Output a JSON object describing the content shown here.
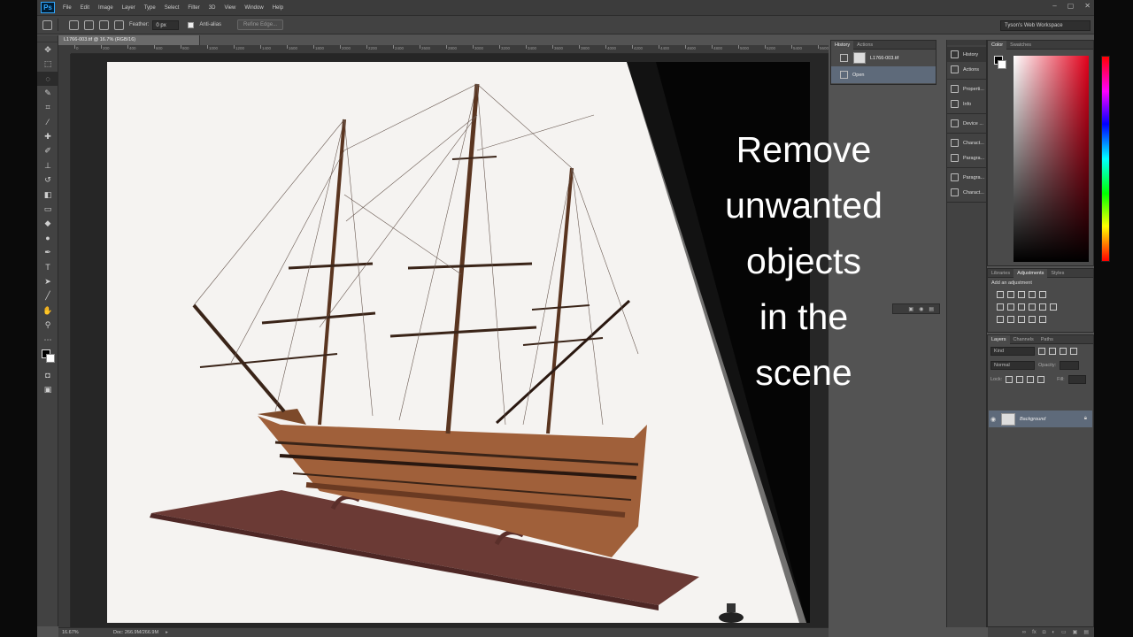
{
  "app": {
    "logo": "Ps",
    "menu": [
      "File",
      "Edit",
      "Image",
      "Layer",
      "Type",
      "Select",
      "Filter",
      "3D",
      "View",
      "Window",
      "Help"
    ],
    "window_controls": [
      "–",
      "▢",
      "✕"
    ]
  },
  "options": {
    "feather_label": "Feather:",
    "feather_value": "0 px",
    "antialias_label": "Anti-alias",
    "refine_edge_label": "Refine Edge...",
    "workspace": "Tyson's Web Workspace"
  },
  "document": {
    "tab_title": "L1766-003.tif @ 16.7% (RGB/16)",
    "zoom": "16.67%",
    "doc_size": "Doc: 266.9M/266.9M",
    "ruler_labels": [
      "0",
      "200",
      "400",
      "600",
      "800",
      "1000",
      "1200",
      "1400",
      "1600",
      "1800",
      "2000",
      "2200",
      "2400",
      "2600",
      "2800",
      "3000",
      "3200",
      "3400",
      "3600",
      "3800",
      "4000",
      "4200",
      "4400",
      "4600",
      "4800",
      "5000",
      "5200",
      "5400",
      "5600"
    ]
  },
  "overlay_text": [
    "Remove",
    "unwanted",
    "objects",
    "in the",
    "scene"
  ],
  "history_panel": {
    "tabs": [
      "History",
      "Actions"
    ],
    "items": [
      {
        "label": "L1766-003.tif"
      },
      {
        "label": "Open"
      }
    ]
  },
  "dock": {
    "groups": [
      [
        "History",
        "Actions"
      ],
      [
        "Properti...",
        "Info"
      ],
      [
        "Device ..."
      ],
      [
        "Charact...",
        "Paragra..."
      ],
      [
        "Paragra...",
        "Charact..."
      ]
    ]
  },
  "color_panel": {
    "tabs": [
      "Color",
      "Swatches"
    ],
    "accent": "#e3001b"
  },
  "adjustments_panel": {
    "tabs": [
      "Libraries",
      "Adjustments",
      "Styles"
    ],
    "title": "Add an adjustment"
  },
  "layers_panel": {
    "tabs": [
      "Layers",
      "Channels",
      "Paths"
    ],
    "kind_label": "Kind",
    "blend_mode": "Normal",
    "opacity_label": "Opacity:",
    "fill_label": "Fill:",
    "lock_label": "Lock:",
    "layer_name": "Background"
  }
}
